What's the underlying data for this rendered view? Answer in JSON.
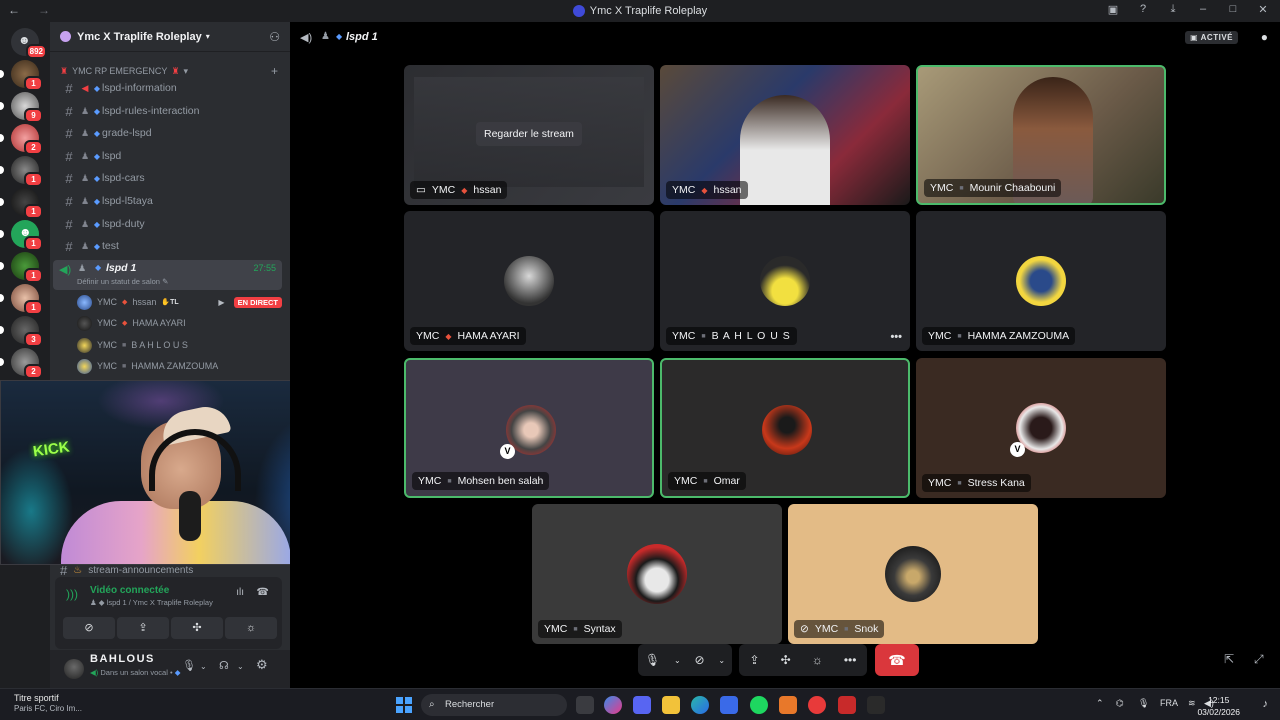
{
  "window": {
    "title": "Ymc X Traplife Roleplay"
  },
  "rail": {
    "home_badge": "892",
    "server_badges": [
      "1",
      "9",
      "2",
      "1",
      "1",
      "1",
      "1",
      "1",
      "3",
      "2"
    ]
  },
  "sidebar": {
    "server_name": "Ymc X Traplife Roleplay",
    "category": "YMC RP EMERGENCY",
    "channels": [
      {
        "name": "lspd-information",
        "icon": "megaphone-icon"
      },
      {
        "name": "lspd-rules-interaction",
        "icon": "hash-icon"
      },
      {
        "name": "grade-lspd",
        "icon": "hash-icon"
      },
      {
        "name": "lspd",
        "icon": "hash-icon"
      },
      {
        "name": "lspd-cars",
        "icon": "hash-icon"
      },
      {
        "name": "lspd-l5taya",
        "icon": "hash-icon"
      },
      {
        "name": "lspd-duty",
        "icon": "hash-icon"
      },
      {
        "name": "test",
        "icon": "hash-icon"
      }
    ],
    "voice_channel": {
      "name": "lspd 1",
      "timer": "27:55",
      "status_hint": "Définir un statut de salon"
    },
    "voice_users": [
      {
        "prefix": "YMC",
        "name": "hssan",
        "tag": "TL",
        "live": "EN DIRECT"
      },
      {
        "prefix": "YMC",
        "name": "HAMA AYARI"
      },
      {
        "prefix": "YMC",
        "name": "B A H L O U S"
      },
      {
        "prefix": "YMC",
        "name": "HAMMA ZAMZOUMA"
      }
    ],
    "stream_channel": "stream-announcements"
  },
  "voice_panel": {
    "title": "Vidéo connectée",
    "subtitle": "lspd 1 / Ymc X Traplife Roleplay"
  },
  "user_panel": {
    "name": "BAHLOUS",
    "status": "Dans un salon vocal •"
  },
  "main": {
    "channel_name": "lspd 1",
    "activity_label": "ACTIVÉ",
    "watch_stream": "Regarder le stream",
    "tiles": [
      {
        "prefix": "YMC",
        "name": "hssan",
        "kind": "stream"
      },
      {
        "prefix": "YMC",
        "name": "hssan",
        "kind": "camera"
      },
      {
        "prefix": "YMC",
        "name": "Mounir Chaabouni",
        "kind": "camera"
      },
      {
        "prefix": "YMC",
        "name": "HAMA AYARI",
        "kind": "avatar"
      },
      {
        "prefix": "YMC",
        "name": "B A H L O U S",
        "kind": "avatar"
      },
      {
        "prefix": "YMC",
        "name": "HAMMA ZAMZOUMA",
        "kind": "avatar"
      },
      {
        "prefix": "YMC",
        "name": "Mohsen ben salah",
        "kind": "avatar"
      },
      {
        "prefix": "YMC",
        "name": "Omar",
        "kind": "avatar"
      },
      {
        "prefix": "YMC",
        "name": "Stress Kana",
        "kind": "avatar"
      },
      {
        "prefix": "YMC",
        "name": "Syntax",
        "kind": "avatar"
      },
      {
        "prefix": "YMC",
        "name": "Snok",
        "kind": "avatar"
      }
    ]
  },
  "taskbar": {
    "weather_title": "Titre sportif",
    "weather_sub": "Paris FC, Ciro Im...",
    "search_placeholder": "Rechercher",
    "lang": "FRA",
    "time": "12:15",
    "date": "03/02/2026"
  },
  "colors": {
    "accent_green": "#23a55a",
    "danger_red": "#da373c",
    "background": "#000000",
    "sidebar": "#2b2d31"
  }
}
